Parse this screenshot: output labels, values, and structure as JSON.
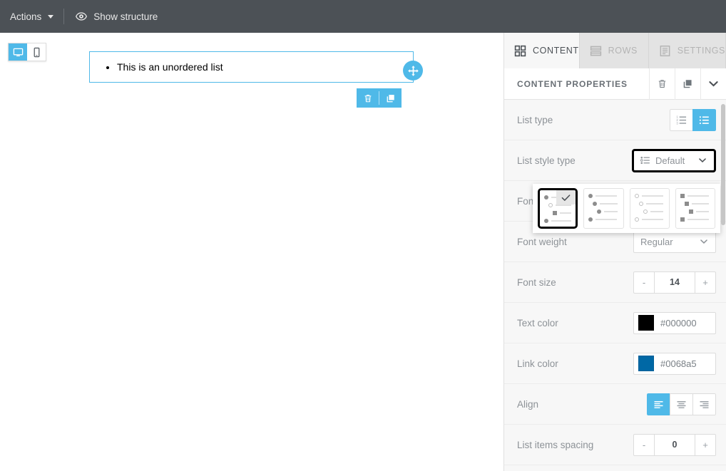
{
  "topbar": {
    "actions_label": "Actions",
    "actions_icon": "chevron-down-icon",
    "show_structure_label": "Show structure",
    "show_structure_icon": "eye-icon",
    "background": "#4c5156"
  },
  "canvas": {
    "device_toggle": {
      "desktop_label": "desktop-view",
      "mobile_label": "mobile-view",
      "active": "desktop",
      "active_color": "#4fb9e8"
    },
    "block": {
      "list_items": [
        "This is an unordered list"
      ],
      "list_style": "disc",
      "border_color": "#4fb9e8",
      "drag_handle_icon": "move-icon",
      "tools": [
        {
          "name": "delete",
          "icon": "trash-icon"
        },
        {
          "name": "duplicate",
          "icon": "copy-icon"
        }
      ]
    }
  },
  "right_panel": {
    "tabs": [
      {
        "label": "CONTENT",
        "icon": "grid-icon",
        "active": true
      },
      {
        "label": "ROWS",
        "icon": "rows-icon",
        "active": false
      },
      {
        "label": "SETTINGS",
        "icon": "settings-doc-icon",
        "active": false
      }
    ],
    "properties_header": {
      "title": "CONTENT PROPERTIES",
      "buttons": [
        {
          "name": "delete",
          "icon": "trash-icon"
        },
        {
          "name": "duplicate",
          "icon": "copy-icon"
        },
        {
          "name": "collapse",
          "icon": "chevron-down-icon"
        }
      ]
    },
    "rows": [
      {
        "label": "List type",
        "control": "segmented",
        "options": [
          {
            "name": "ordered-list",
            "icon": "ordered-list-icon",
            "active": false
          },
          {
            "name": "unordered-list",
            "icon": "unordered-list-icon",
            "active": true
          }
        ]
      },
      {
        "label": "List style type",
        "control": "select",
        "value": "Default",
        "icon": "list-style-icon",
        "focused": true
      },
      {
        "label": "Font family",
        "label_truncated": "Font",
        "control": "select",
        "value": "",
        "obscured": true
      },
      {
        "label": "Font weight",
        "control": "select",
        "value": "Regular"
      },
      {
        "label": "Font size",
        "control": "stepper",
        "value": "14",
        "minus": "-",
        "plus": "+"
      },
      {
        "label": "Text color",
        "control": "color",
        "value": "#000000"
      },
      {
        "label": "Link color",
        "control": "color",
        "value": "#0068a5"
      },
      {
        "label": "Align",
        "control": "segmented",
        "options": [
          {
            "name": "align-left",
            "icon": "align-left-icon",
            "active": true
          },
          {
            "name": "align-center",
            "icon": "align-center-icon",
            "active": false
          },
          {
            "name": "align-right",
            "icon": "align-right-icon",
            "active": false
          }
        ]
      },
      {
        "label": "List items spacing",
        "control": "stepper",
        "value": "0",
        "minus": "-",
        "plus": "+"
      }
    ],
    "style_popup": {
      "options": [
        {
          "name": "default",
          "markers": [
            "disc",
            "circle",
            "square",
            "disc"
          ],
          "selected": true,
          "check_icon": "check-icon"
        },
        {
          "name": "disc",
          "markers": [
            "disc",
            "disc",
            "disc",
            "disc"
          ],
          "selected": false
        },
        {
          "name": "circle",
          "markers": [
            "circle",
            "circle",
            "circle",
            "circle"
          ],
          "selected": false
        },
        {
          "name": "square",
          "markers": [
            "square",
            "square",
            "square",
            "square"
          ],
          "selected": false
        }
      ]
    },
    "accent_color": "#4fb9e8",
    "background": "#f7f7f7"
  }
}
